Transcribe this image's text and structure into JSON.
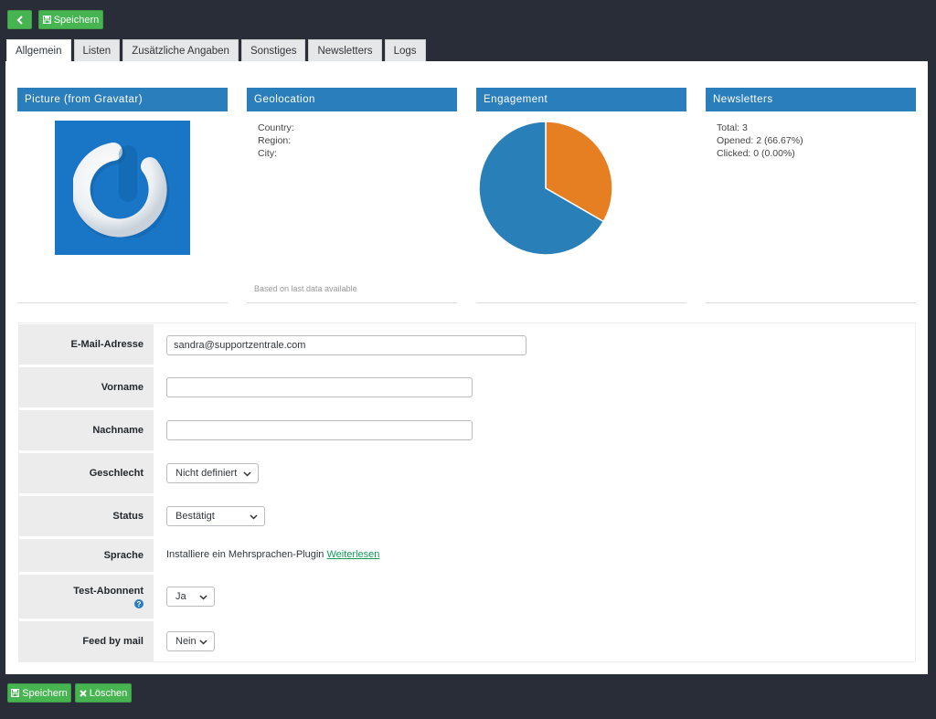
{
  "toolbar": {
    "back_icon": "chevron-left-icon",
    "save_label": "Speichern",
    "save_icon": "floppy-disk-icon"
  },
  "tabs": [
    {
      "label": "Allgemein",
      "active": true
    },
    {
      "label": "Listen"
    },
    {
      "label": "Zusätzliche Angaben"
    },
    {
      "label": "Sonstiges"
    },
    {
      "label": "Newsletters"
    },
    {
      "label": "Logs"
    }
  ],
  "picture": {
    "title": "Picture (from Gravatar)",
    "icon": "gravatar-logo"
  },
  "geolocation": {
    "title": "Geolocation",
    "country_label": "Country:",
    "region_label": "Region:",
    "city_label": "City:",
    "note": "Based on last data available"
  },
  "engagement": {
    "title": "Engagement"
  },
  "chart_data": {
    "type": "pie",
    "categories": [
      "orange",
      "blue"
    ],
    "values": [
      33.33,
      66.67
    ],
    "colors": [
      "#e67e22",
      "#2980b9"
    ],
    "title": "",
    "legend": "none"
  },
  "newsletters": {
    "title": "Newsletters",
    "total": "Total: 3",
    "opened": "Opened: 2 (66.67%)",
    "clicked": "Clicked: 0 (0.00%)"
  },
  "form": {
    "email": {
      "label": "E-Mail-Adresse",
      "value": "sandra@supportzentrale.com"
    },
    "firstname": {
      "label": "Vorname",
      "value": ""
    },
    "lastname": {
      "label": "Nachname",
      "value": ""
    },
    "gender": {
      "label": "Geschlecht",
      "value": "Nicht definiert"
    },
    "status": {
      "label": "Status",
      "value": "Bestätigt"
    },
    "language": {
      "label": "Sprache",
      "text": "Installiere ein Mehrsprachen-Plugin",
      "link": "Weiterlesen"
    },
    "test": {
      "label": "Test-Abonnent",
      "value": "Ja",
      "help_icon": "question-circle-icon"
    },
    "feed": {
      "label": "Feed by mail",
      "value": "Nein"
    }
  },
  "footer": {
    "save_label": "Speichern",
    "delete_label": "Löschen",
    "delete_icon": "x-icon"
  },
  "colors": {
    "background": "#282d37",
    "button_green": "#46b450",
    "header_blue": "#2a7ebb",
    "pie_orange": "#e67e22",
    "pie_blue": "#2980b9",
    "link_green": "#0f9d58"
  }
}
